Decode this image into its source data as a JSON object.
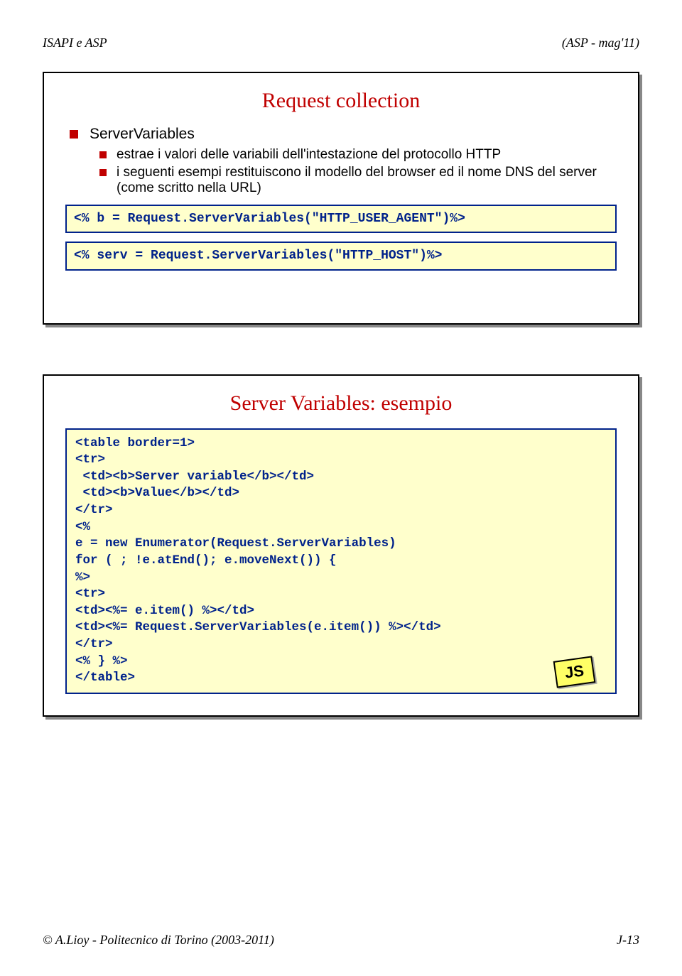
{
  "header": {
    "left": "ISAPI e ASP",
    "right": "(ASP - mag'11)"
  },
  "slide1": {
    "title": "Request collection",
    "b1": "ServerVariables",
    "b1a": "estrae i valori delle variabili dell'intestazione del protocollo HTTP",
    "b1b": "i seguenti esempi restituiscono il modello del browser ed il nome DNS del server (come scritto nella URL)",
    "code1": "<% b = Request.ServerVariables(\"HTTP_USER_AGENT\")%>",
    "code2": "<% serv = Request.ServerVariables(\"HTTP_HOST\")%>"
  },
  "slide2": {
    "title": "Server Variables: esempio",
    "code": "<table border=1>\n<tr>\n <td><b>Server variable</b></td>\n <td><b>Value</b></td>\n</tr>\n<%\ne = new Enumerator(Request.ServerVariables)\nfor ( ; !e.atEnd(); e.moveNext()) {\n%>\n<tr>\n<td><%= e.item() %></td>\n<td><%= Request.ServerVariables(e.item()) %></td>\n</tr>\n<% } %>\n</table>",
    "badge": "JS"
  },
  "footer": {
    "left": "© A.Lioy - Politecnico di Torino (2003-2011)",
    "right": "J-13"
  }
}
